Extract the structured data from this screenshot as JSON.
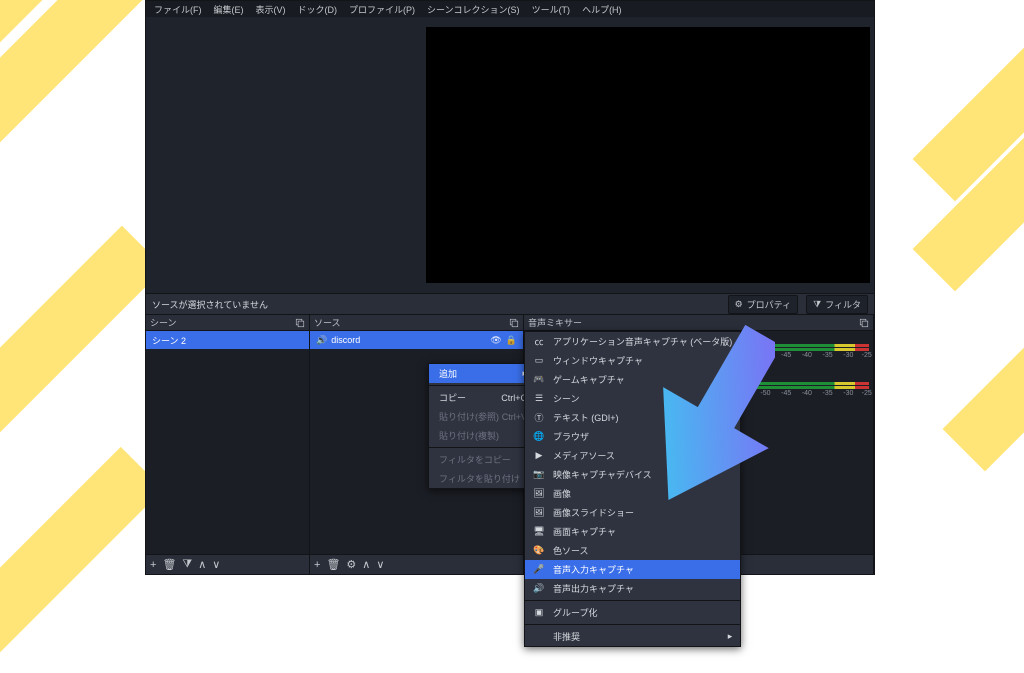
{
  "menubar": [
    "ファイル(F)",
    "編集(E)",
    "表示(V)",
    "ドック(D)",
    "プロファイル(P)",
    "シーンコレクション(S)",
    "ツール(T)",
    "ヘルプ(H)"
  ],
  "toolbar": {
    "no_selection": "ソースが選択されていません",
    "properties": "プロパティ",
    "filters": "フィルタ"
  },
  "panels": {
    "scene": {
      "title": "シーン"
    },
    "sources": {
      "title": "ソース"
    },
    "mixer": {
      "title": "音声ミキサー"
    }
  },
  "scene_items": [
    "シーン 2"
  ],
  "source_items": [
    {
      "label": "discord"
    }
  ],
  "mixer": {
    "ticks": [
      "-50",
      "-45",
      "-40",
      "-35",
      "-30",
      "-25"
    ]
  },
  "ctx_menu": {
    "add": "追加",
    "copy": {
      "label": "コピー",
      "shortcut": "Ctrl+C"
    },
    "paste_ref": {
      "label": "貼り付け(参照)",
      "shortcut": "Ctrl+V"
    },
    "paste_dup": "貼り付け(複製)",
    "copy_filters": "フィルタをコピー",
    "paste_filters": "フィルタを貼り付け"
  },
  "submenu": {
    "items": [
      {
        "icon": "cc",
        "label": "アプリケーション音声キャプチャ (ベータ版)"
      },
      {
        "icon": "window",
        "label": "ウィンドウキャプチャ"
      },
      {
        "icon": "game",
        "label": "ゲームキャプチャ"
      },
      {
        "icon": "scene",
        "label": "シーン"
      },
      {
        "icon": "text",
        "label": "テキスト (GDI+)"
      },
      {
        "icon": "browser",
        "label": "ブラウザ"
      },
      {
        "icon": "media",
        "label": "メディアソース"
      },
      {
        "icon": "camera",
        "label": "映像キャプチャデバイス"
      },
      {
        "icon": "image",
        "label": "画像"
      },
      {
        "icon": "slideshow",
        "label": "画像スライドショー"
      },
      {
        "icon": "display",
        "label": "画面キャプチャ"
      },
      {
        "icon": "color",
        "label": "色ソース"
      },
      {
        "icon": "mic",
        "label": "音声入力キャプチャ",
        "active": true
      },
      {
        "icon": "speaker",
        "label": "音声出力キャプチャ"
      }
    ],
    "group": "グループ化",
    "deprecated": "非推奨"
  },
  "footer_icons": {
    "plus": "+",
    "trash": "🗑",
    "gear": "⚙",
    "up": "∧",
    "down": "∨",
    "filter": "⧩"
  }
}
